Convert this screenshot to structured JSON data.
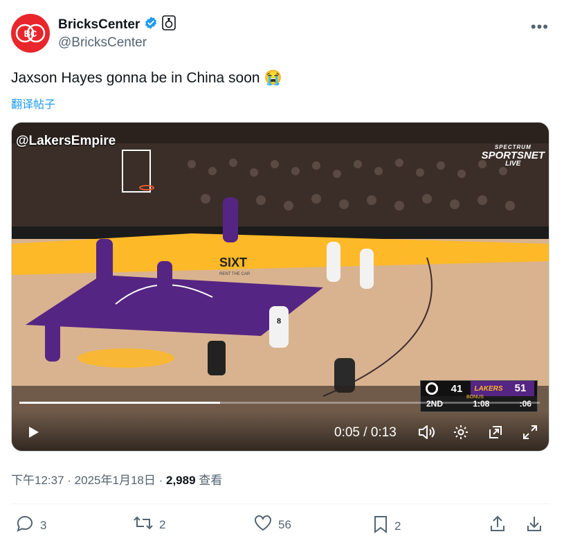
{
  "author": {
    "display_name": "BricksCenter",
    "handle": "@BricksCenter",
    "avatar_text": "BC",
    "verified": true
  },
  "tweet": {
    "text": "Jaxson Hayes gonna be in China soon",
    "emoji": "😭",
    "translate_label": "翻译帖子"
  },
  "video": {
    "watermark": "@LakersEmpire",
    "broadcast_line1": "SPECTRUM",
    "broadcast_line2": "SPORTSNET",
    "broadcast_line3": "LIVE",
    "court_sponsor": "SIXT",
    "court_sponsor_sub": "RENT THE CAR",
    "jersey_number": "8",
    "time_display": "0:05 / 0:13",
    "progress": 0.385,
    "scoreboard": {
      "away_score": "41",
      "home_score": "51",
      "home_team": "LAKERS",
      "bonus": "BONUS",
      "quarter": "2ND",
      "game_clock": "1:08",
      "shot_clock": ":06"
    }
  },
  "meta": {
    "time": "下午12:37",
    "date": "2025年1月18日",
    "views": "2,989",
    "views_label": "查看"
  },
  "actions": {
    "replies": "3",
    "retweets": "2",
    "likes": "56",
    "bookmarks": "2"
  },
  "colors": {
    "accent": "#1d9bf0",
    "avatar_red": "#e8262b",
    "verified": "#1d9bf0",
    "lakers_purple": "#552583",
    "lakers_gold": "#fdb927"
  }
}
